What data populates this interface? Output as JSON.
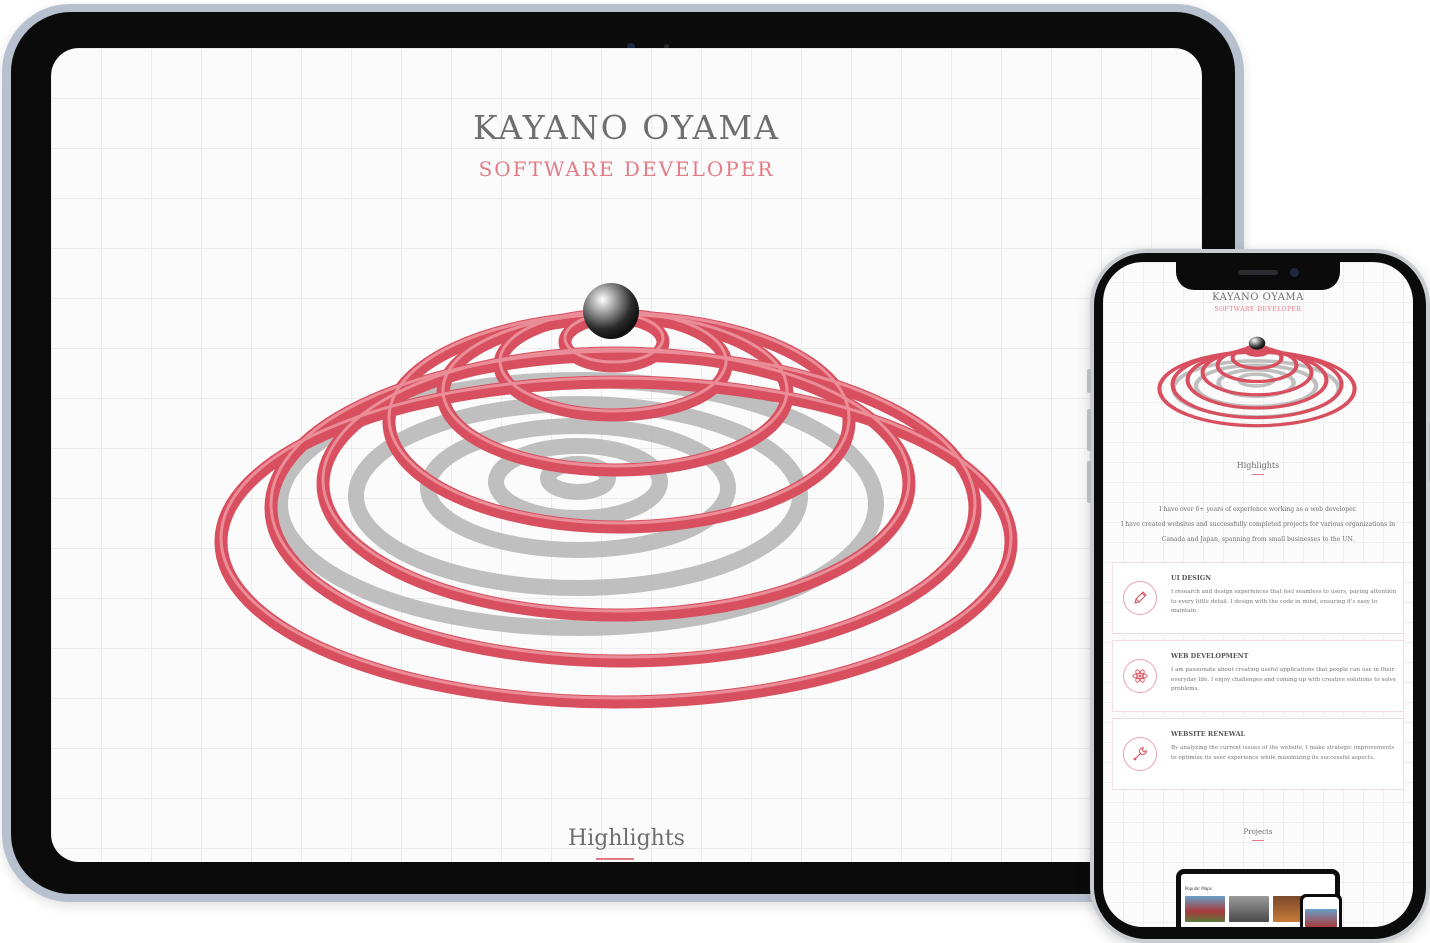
{
  "tablet": {
    "title": "KAYANO OYAMA",
    "subtitle": "SOFTWARE DEVELOPER",
    "highlights_heading": "Highlights"
  },
  "phone": {
    "title": "KAYANO OYAMA",
    "subtitle": "SOFTWARE DEVELOPER",
    "highlights_heading": "Highlights",
    "intro": [
      "I have over 6+ years of experience working as a web developer.",
      "I have created websites and successfully completed projects for various organizations in Canada and Japan, spanning from small businesses to the UN."
    ],
    "cards": [
      {
        "icon": "pencil-icon",
        "heading": "UI DESIGN",
        "text": "I research and design experiences that feel seamless to users, paying attention to every little detail. I design with the code in mind, ensuring it's easy to maintain."
      },
      {
        "icon": "atom-icon",
        "heading": "WEB DEVELOPMENT",
        "text": "I am passionate about creating useful applications that people can use in their everyday life. I enjoy challenges and coming up with creative solutions to solve problems."
      },
      {
        "icon": "wrench-icon",
        "heading": "WEBSITE RENEWAL",
        "text": "By analyzing the current issues of the website, I make strategic improvements to optimize its user experience while maximizing its successful aspects."
      }
    ],
    "projects_heading": "Projects",
    "project_preview": {
      "heading": "Popular Maps"
    }
  },
  "colors": {
    "accent": "#e37b86",
    "coil": "#d8505f",
    "heading_gray": "#6e6e6e",
    "device_black": "#0b0b0c",
    "tablet_bezel": "#b7c0cf"
  }
}
